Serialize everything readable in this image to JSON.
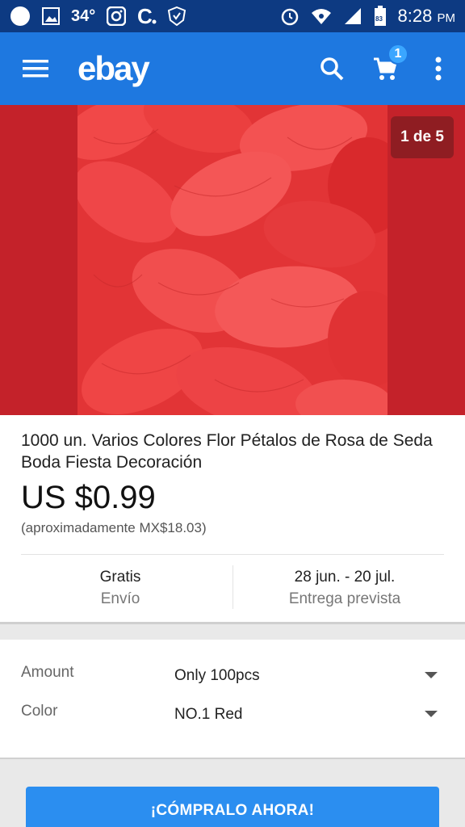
{
  "status_bar": {
    "temp": "34°",
    "time": "8:28",
    "ampm": "PM",
    "battery": "83"
  },
  "app_bar": {
    "logo": "ebay",
    "cart_count": "1",
    "colors": {
      "bar": "#1e78e0",
      "status": "#0d3a82"
    }
  },
  "gallery": {
    "counter": "1 de 5",
    "background": "#c4222a"
  },
  "product": {
    "title": "1000 un. Varios Colores Flor Pétalos de Rosa de Seda Boda Fiesta Decoración",
    "price": "US $0.99",
    "approx_price": "(aproximadamente MX$18.03)",
    "shipping_value": "Gratis",
    "shipping_label": "Envío",
    "delivery_value": "28 jun. - 20 jul.",
    "delivery_label": "Entrega prevista"
  },
  "variations": [
    {
      "label": "Amount",
      "value": "Only 100pcs"
    },
    {
      "label": "Color",
      "value": "NO.1 Red"
    }
  ],
  "buy_button": {
    "label": "¡CÓMPRALO AHORA!",
    "color": "#2b8ef0"
  }
}
